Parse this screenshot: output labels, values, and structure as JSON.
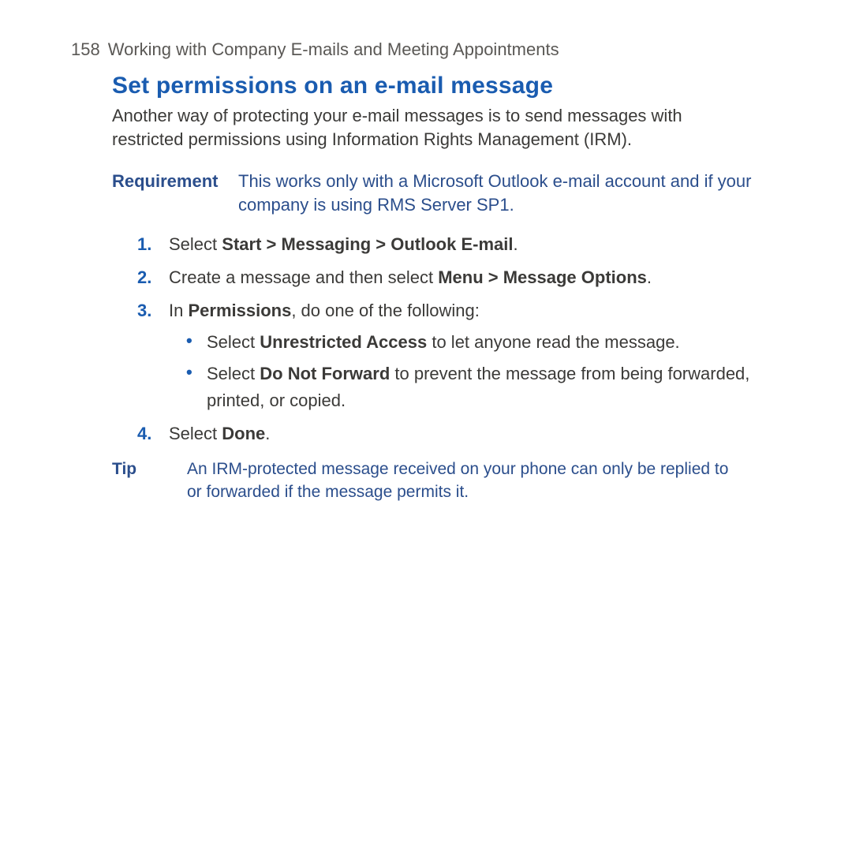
{
  "page": {
    "number": "158",
    "running": "Working with Company E-mails and Meeting Appointments"
  },
  "title": "Set permissions on an e-mail message",
  "lead": "Another way of protecting your e-mail messages is to send messages with restricted permissions using Information Rights Management (IRM).",
  "requirement": {
    "label": "Requirement",
    "body": "This works only with a Microsoft Outlook e-mail account and if your company is using RMS Server SP1."
  },
  "steps": {
    "s1a": "Select ",
    "s1b": "Start > Messaging > Outlook E-mail",
    "s1c": ".",
    "s2a": "Create a message and then select ",
    "s2b": "Menu > Message Options",
    "s2c": ".",
    "s3a": "In ",
    "s3b": "Permissions",
    "s3c": ", do one of the following:",
    "s3_1a": "Select ",
    "s3_1b": "Unrestricted Access",
    "s3_1c": " to let anyone read the message.",
    "s3_2a": "Select ",
    "s3_2b": "Do Not Forward",
    "s3_2c": " to prevent the message from being forwarded, printed, or copied.",
    "s4a": "Select ",
    "s4b": "Done",
    "s4c": "."
  },
  "tip": {
    "label": "Tip",
    "body": "An IRM-protected message received on your phone can only be replied to or forwarded if the message permits it."
  }
}
